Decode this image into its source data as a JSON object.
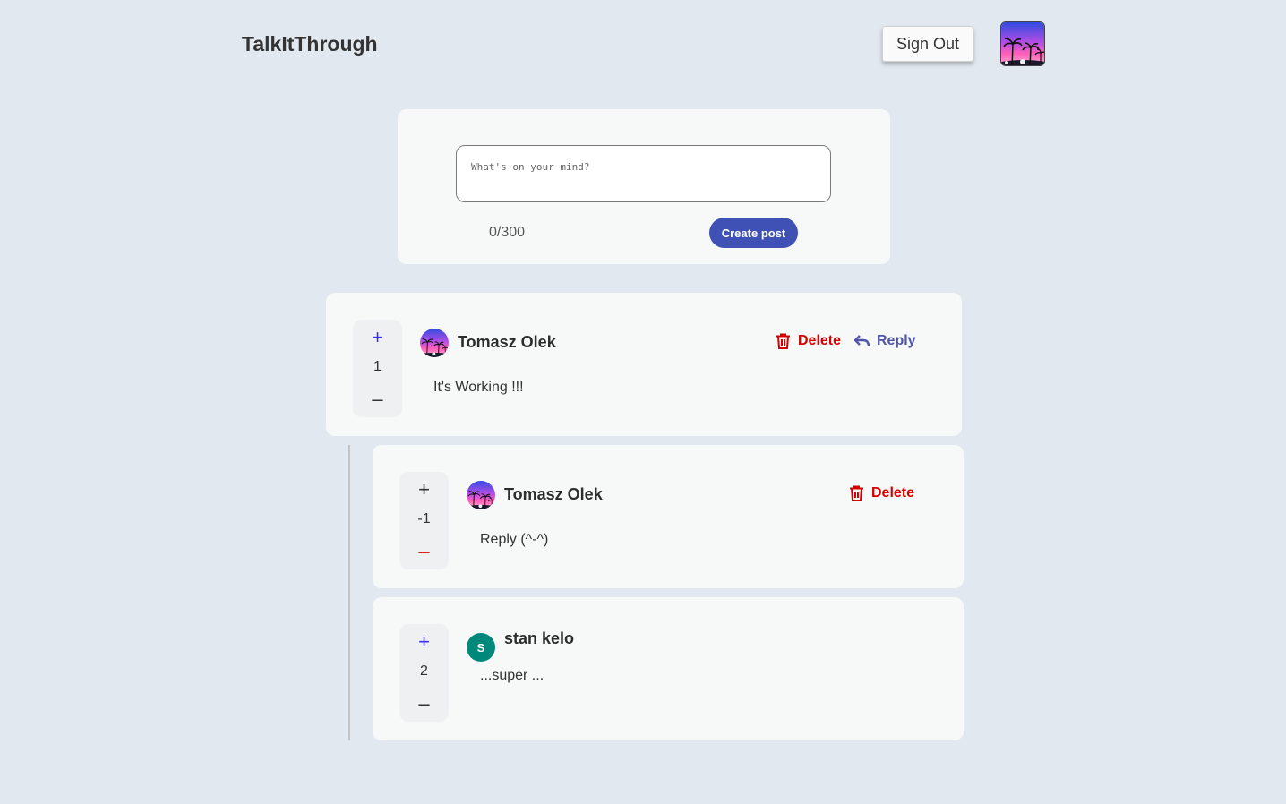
{
  "header": {
    "title": "TalkItThrough",
    "sign_out_label": "Sign Out",
    "avatar_icon": "profile-photo-palm-sunset"
  },
  "composer": {
    "placeholder": "What's on your mind?",
    "value": "",
    "char_count": "0/300",
    "create_label": "Create post"
  },
  "posts": [
    {
      "author": "Tomasz Olek",
      "avatar": "palm-sunset-photo",
      "text": "It's Working !!!",
      "votes": "1",
      "vote_state": "up",
      "delete_label": "Delete",
      "reply_label": "Reply"
    },
    {
      "author": "Tomasz Olek",
      "avatar": "palm-sunset-photo",
      "text": "Reply (^-^)",
      "votes": "-1",
      "vote_state": "down",
      "delete_label": "Delete"
    },
    {
      "author": "stan kelo",
      "avatar_letter": "S",
      "avatar_color": "#00897b",
      "text": "...super ...",
      "votes": "2",
      "vote_state": "up"
    }
  ],
  "colors": {
    "background": "#e2e8f0",
    "card": "#f7f8f8",
    "primary": "#3f51b5",
    "delete": "#d50000",
    "reply": "#5055a8",
    "upvote_active": "#3a2ee8",
    "downvote_active": "#e02020"
  }
}
